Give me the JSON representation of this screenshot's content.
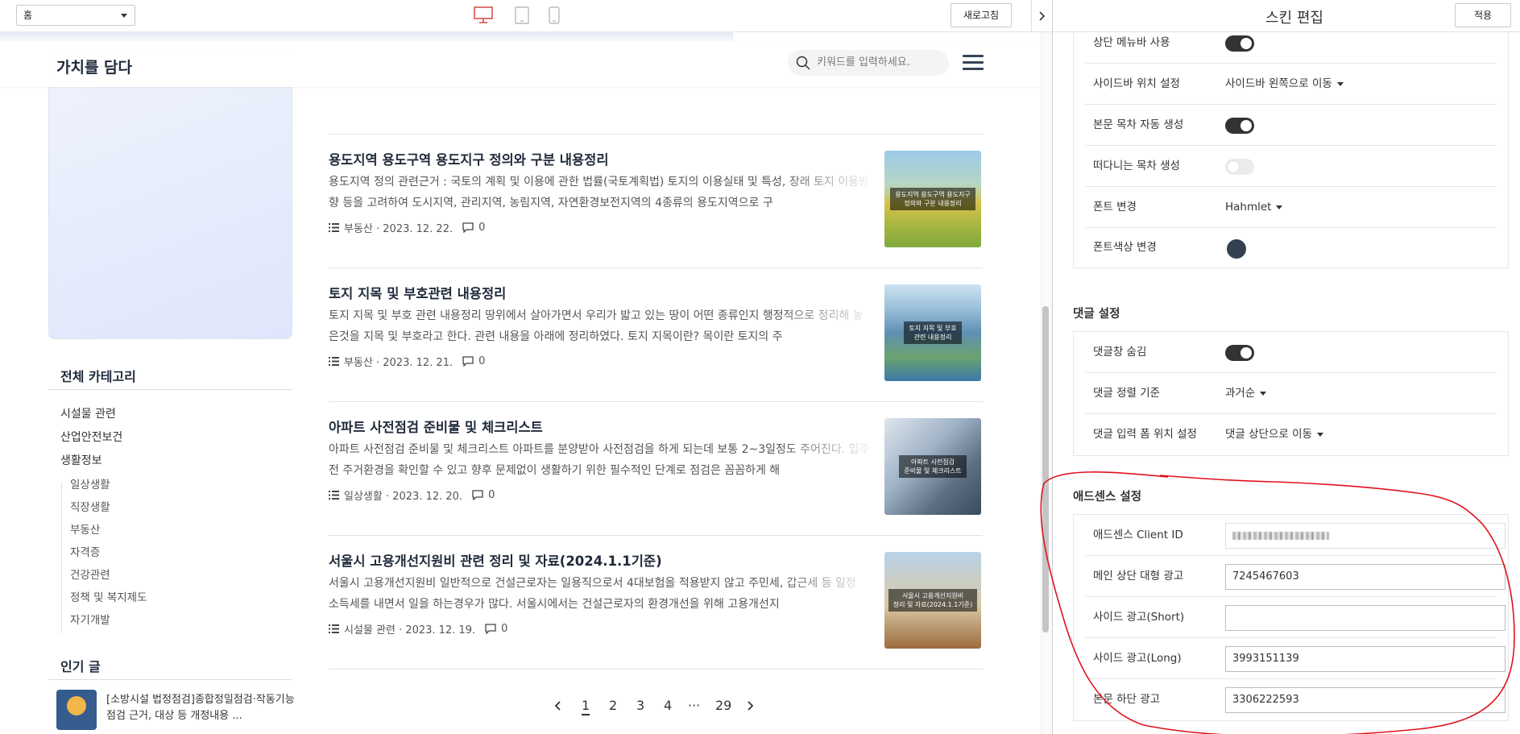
{
  "topbar": {
    "page_select": "홈",
    "refresh_label": "새로고침"
  },
  "blog": {
    "title": "가치를 담다",
    "search_placeholder": "키워드를 입력하세요."
  },
  "sidebar": {
    "category_heading": "전체 카테고리",
    "categories": [
      {
        "label": "시설물 관련"
      },
      {
        "label": "산업안전보건"
      },
      {
        "label": "생활정보"
      }
    ],
    "subcategories": [
      {
        "label": "일상생활"
      },
      {
        "label": "직장생활"
      },
      {
        "label": "부동산"
      },
      {
        "label": "자격증"
      },
      {
        "label": "건강관련"
      },
      {
        "label": "정책 및 복지제도"
      },
      {
        "label": "자기개발"
      }
    ],
    "popular_heading": "인기 글",
    "popular_post": "[소방시설 법정점검]종합정밀점검·작동기능점검 근거, 대상 등 개정내용 ..."
  },
  "posts": [
    {
      "title": "용도지역 용도구역 용도지구 정의와 구분 내용정리",
      "excerpt": "용도지역 정의 관련근거 : 국토의 계획 및 이용에 관한 법률(국토계획법) 토지의 이용실태 및 특성, 장래 토지 이용방향 등을 고려하여 도시지역, 관리지역, 농림지역, 자연환경보전지역의 4종류의 용도지역으로 구",
      "meta": "부동산 · 2023. 12. 22.",
      "comments": "0",
      "thumb_caption": "용도지역 용도구역 용도지구\n정의와 구분 내용정리"
    },
    {
      "title": "토지 지목 및 부호관련 내용정리",
      "excerpt": "토지 지목 및 부호 관련 내용정리 땅위에서 살아가면서 우리가 밟고 있는 땅이 어떤 종류인지 행정적으로 정리해 놓은것을 지목 및 부호라고 한다. 관련 내용을 아래에 정리하였다. 토지 지목이란? 목이란 토지의 주",
      "meta": "부동산 · 2023. 12. 21.",
      "comments": "0",
      "thumb_caption": "토지 지목 및 부호\n관련 내용정리"
    },
    {
      "title": "아파트 사전점검 준비물 및 체크리스트",
      "excerpt": "아파트 사전점검 준비물 및 체크리스트 아파트를 분양받아 사전점검을 하게 되는데 보통 2~3일정도 주어진다. 입주 전 주거환경을 확인할 수 있고 향후 문제없이 생활하기 위한 필수적인 단계로 점검은 꼼꼼하게 해",
      "meta": "일상생활 · 2023. 12. 20.",
      "comments": "0",
      "thumb_caption": "아파트 사전점검\n준비물 및 체크리스트"
    },
    {
      "title": "서울시 고용개선지원비 관련 정리 및 자료(2024.1.1기준)",
      "excerpt": "서울시 고용개선지원비 일반적으로 건설근로자는 일용직으로서 4대보험을 적용받지 않고 주민세, 갑근세 등 일정 소득세를 내면서 일을 하는경우가 많다. 서울시에서는 건설근로자의 환경개선을 위해 고용개선지",
      "meta": "시설물 관련 · 2023. 12. 19.",
      "comments": "0",
      "thumb_caption": "서울시 고용개선지원비\n정리 및 자료(2024.1.1기준)"
    }
  ],
  "pagination": {
    "pages": [
      "1",
      "2",
      "3",
      "4"
    ],
    "ellipsis": "···",
    "last": "29",
    "current": "1"
  },
  "skin": {
    "title": "스킨 편집",
    "apply_label": "적용",
    "layout_rows": [
      {
        "label": "상단 메뉴바 사용",
        "type": "toggle",
        "on": true
      },
      {
        "label": "사이드바 위치 설정",
        "type": "dropdown",
        "value": "사이드바 왼쪽으로 이동"
      },
      {
        "label": "본문 목차 자동 생성",
        "type": "toggle",
        "on": true
      },
      {
        "label": "떠다니는 목차 생성",
        "type": "toggle",
        "on": false
      },
      {
        "label": "폰트 변경",
        "type": "dropdown",
        "value": "Hahmlet"
      },
      {
        "label": "폰트색상 변경",
        "type": "color",
        "value": "#34404f"
      }
    ],
    "comment_heading": "댓글 설정",
    "comment_rows": [
      {
        "label": "댓글창 숨김",
        "type": "toggle",
        "on": true
      },
      {
        "label": "댓글 정렬 기준",
        "type": "dropdown",
        "value": "과거순"
      },
      {
        "label": "댓글 입력 폼 위치 설정",
        "type": "dropdown",
        "value": "댓글 상단으로 이동"
      }
    ],
    "adsense_heading": "애드센스 설정",
    "adsense_rows": [
      {
        "label": "애드센스 Client ID",
        "value": ""
      },
      {
        "label": "메인 상단 대형 광고",
        "value": "7245467603"
      },
      {
        "label": "사이드 광고(Short)",
        "value": ""
      },
      {
        "label": "사이드 광고(Long)",
        "value": "3993151139"
      },
      {
        "label": "본문 하단 광고",
        "value": "3306222593"
      }
    ]
  },
  "colors": {
    "accent": "#d9534f",
    "annotation": "#e0121d",
    "toggle_on": "#333333",
    "font_color_swatch": "#34404f"
  }
}
